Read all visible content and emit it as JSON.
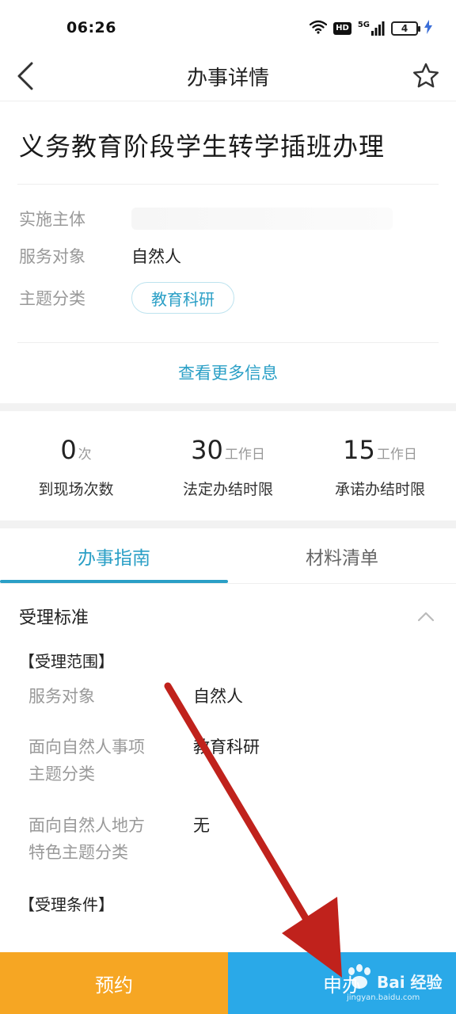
{
  "status_bar": {
    "time": "06:26",
    "hd": "HD",
    "network": "5G",
    "battery": "4",
    "icons": [
      "wifi-icon",
      "signal-icon",
      "charging-icon"
    ]
  },
  "nav": {
    "title": "办事详情",
    "back_icon": "chevron-left-icon",
    "favorite_icon": "star-outline-icon"
  },
  "item": {
    "title": "义务教育阶段学生转学插班办理",
    "info": [
      {
        "label": "实施主体",
        "value": ""
      },
      {
        "label": "服务对象",
        "value": "自然人"
      },
      {
        "label": "主题分类",
        "value": "教育科研"
      }
    ],
    "more_link": "查看更多信息"
  },
  "stats": [
    {
      "value": "0",
      "unit": "次",
      "label": "到现场次数"
    },
    {
      "value": "30",
      "unit": "工作日",
      "label": "法定办结时限"
    },
    {
      "value": "15",
      "unit": "工作日",
      "label": "承诺办结时限"
    }
  ],
  "tabs": [
    {
      "label": "办事指南",
      "active": true
    },
    {
      "label": "材料清单",
      "active": false
    }
  ],
  "section": {
    "title": "受理标准",
    "collapse_icon": "chevron-up-icon",
    "scope_heading": "【受理范围】",
    "details": [
      {
        "label": "服务对象",
        "value": "自然人"
      },
      {
        "label": "面向自然人事项\n主题分类",
        "value": "教育科研"
      },
      {
        "label": "面向自然人地方\n特色主题分类",
        "value": "无"
      }
    ],
    "condition_heading": "【受理条件】"
  },
  "bottom": {
    "reserve": "预约",
    "apply": "申办"
  },
  "watermark": {
    "text": "Bai 经验",
    "url": "jingyan.baidu.com"
  },
  "colors": {
    "accent": "#2a9fc6",
    "reserve_button": "#f6a623",
    "apply_button": "#2aa9e8",
    "arrow": "#c0221c"
  }
}
